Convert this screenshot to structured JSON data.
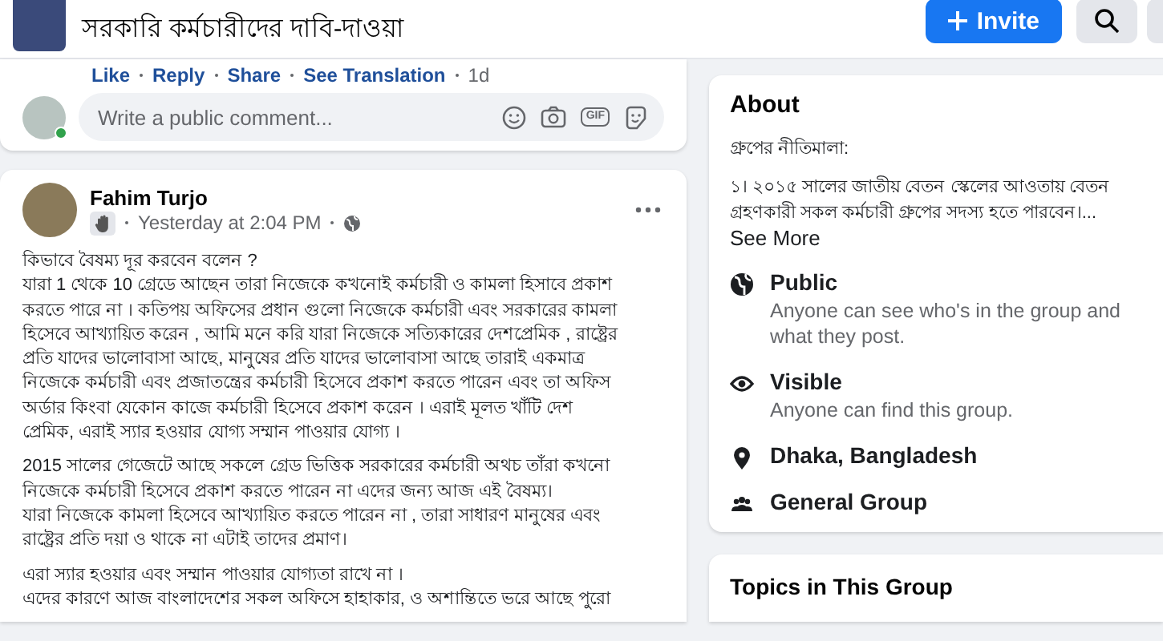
{
  "header": {
    "title": "সরকারি কর্মচারীদের দাবি-দাওয়া",
    "invite": "Invite"
  },
  "comment": {
    "actions": [
      {
        "label": "Like"
      },
      {
        "label": "Reply"
      },
      {
        "label": "Share"
      },
      {
        "label": "See Translation"
      }
    ],
    "time": "1d",
    "online": true,
    "placeholder": "Write a public comment...",
    "gif": "GIF"
  },
  "post": {
    "author": "Fahim Turjo",
    "time": "Yesterday at 2:04 PM",
    "paragraphs": [
      "কিভাবে বৈষম্য দূর করবেন বলেন ?\nযারা 1 থেকে 10 গ্রেডে আছেন তারা নিজেকে কখনোই কর্মচারী ও কামলা হিসাবে প্রকাশ\nকরতে পারে না । কতিপয় অফিসের প্রধান গুলো নিজেকে কর্মচারী এবং সরকারের কামলা\nহিসেবে আখ্যায়িত করেন , আমি মনে করি যারা নিজেকে সত্যিকারের দেশপ্রেমিক , রাষ্ট্রের\nপ্রতি যাদের ভালোবাসা আছে,  মানুষের প্রতি যাদের ভালোবাসা আছে তারাই একমাত্র\nনিজেকে কর্মচারী এবং প্রজাতন্ত্রের কর্মচারী হিসেবে প্রকাশ করতে পারেন এবং তা অফিস\nঅর্ডার কিংবা যেকোন কাজে কর্মচারী হিসেবে প্রকাশ করেন । এরাই মূলত খাঁটি দেশ\nপ্রেমিক, এরাই স্যার হওয়ার যোগ্য সম্মান পাওয়ার যোগ্য ।",
      "2015 সালের গেজেটে আছে সকলে গ্রেড ভিত্তিক সরকারের কর্মচারী অথচ তাঁরা কখনো\nনিজেকে কর্মচারী হিসেবে প্রকাশ করতে পারেন না এদের জন্য আজ এই বৈষম্য।\nযারা নিজেকে কামলা হিসেবে আখ্যায়িত করতে পারেন না , তারা সাধারণ মানুষের এবং\nরাষ্ট্রের প্রতি দয়া ও থাকে না এটাই তাদের প্রমাণ।",
      "এরা স্যার হওয়ার এবং সম্মান পাওয়ার যোগ্যতা রাখে না ।\nএদের কারণে আজ বাংলাদেশের সকল অফিসে হাহাকার, ও অশান্তিতে ভরে আছে পুরো"
    ]
  },
  "about": {
    "title": "About",
    "rules_title": "গ্রুপের নীতিমালা:",
    "rules": "১। ২০১৫ সালের জাতীয় বেতন স্কেলের আওতায় বেতন গ্রহণকারী সকল কর্মচারী গ্রুপের সদস্য হতে পারবেন।...",
    "see_more": "See More",
    "items": [
      {
        "kind": "public",
        "title": "Public",
        "desc": "Anyone can see who's in the group and what they post."
      },
      {
        "kind": "visible",
        "title": "Visible",
        "desc": "Anyone can find this group."
      },
      {
        "kind": "location",
        "title": "Dhaka, Bangladesh"
      },
      {
        "kind": "group",
        "title": "General Group"
      }
    ]
  },
  "topics": {
    "title": "Topics in This Group"
  }
}
